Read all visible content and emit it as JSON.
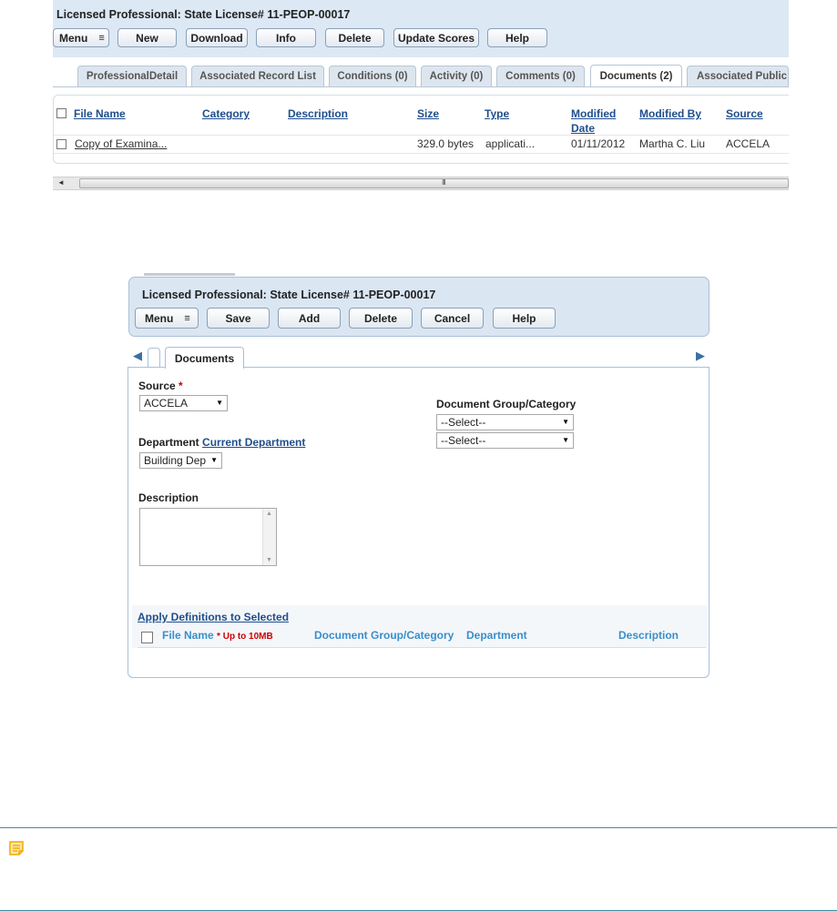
{
  "top": {
    "title": "Licensed Professional: State License# 11-PEOP-00017",
    "toolbar": {
      "menu_label": "Menu",
      "menu_glyph": "≡",
      "new_label": "New",
      "download_label": "Download",
      "info_label": "Info",
      "delete_label": "Delete",
      "update_scores_label": "Update Scores",
      "help_label": "Help"
    },
    "tabs": [
      {
        "label": "ProfessionalDetail"
      },
      {
        "label": "Associated Record List"
      },
      {
        "label": "Conditions (0)"
      },
      {
        "label": "Activity (0)"
      },
      {
        "label": "Comments (0)"
      },
      {
        "label": "Documents (2)"
      },
      {
        "label": "Associated Public U"
      }
    ],
    "grid": {
      "headers": {
        "file_name": "File Name",
        "category": "Category",
        "description": "Description",
        "size": "Size",
        "type": "Type",
        "modified_date_1": "Modified",
        "modified_date_2": "Date",
        "modified_by": "Modified By",
        "source": "Source"
      },
      "row": {
        "file_name": "Copy of Examina...",
        "size": "329.0 bytes",
        "type": "applicati...",
        "modified_date": "01/11/2012",
        "modified_by": "Martha C. Liu",
        "source": "ACCELA"
      }
    },
    "scrollbar": {
      "grip": "III",
      "left_arrow": "◄"
    }
  },
  "dialog": {
    "title": "Licensed Professional: State License# 11-PEOP-00017",
    "toolbar": {
      "menu_label": "Menu",
      "menu_glyph": "≡",
      "save_label": "Save",
      "add_label": "Add",
      "delete_label": "Delete",
      "cancel_label": "Cancel",
      "help_label": "Help"
    },
    "tab_label": "Documents",
    "nav_left": "◀",
    "nav_right": "▶",
    "source": {
      "label": "Source",
      "required_mark": "*",
      "value": "ACCELA"
    },
    "department": {
      "label": "Department",
      "link": "Current Department",
      "value": "Building Dep"
    },
    "description": {
      "label": "Description",
      "value": ""
    },
    "doc_group": {
      "label": "Document Group/Category",
      "select1": "--Select--",
      "select2": "--Select--"
    },
    "apply_link": "Apply Definitions to Selected",
    "columns": {
      "file_name": "File Name",
      "limit": "* Up to 10MB",
      "doc_group": "Document Group/Category",
      "department": "Department",
      "description": "Description"
    }
  },
  "colors": {
    "header_bg": "#dce8f4",
    "link_blue": "#1f4e8c",
    "column_blue": "#3a8ec9",
    "required_red": "#cc0000",
    "note_rule": "#3c8fa5",
    "note_icon": "#f2a900"
  },
  "icons": {
    "note": "note-icon"
  }
}
